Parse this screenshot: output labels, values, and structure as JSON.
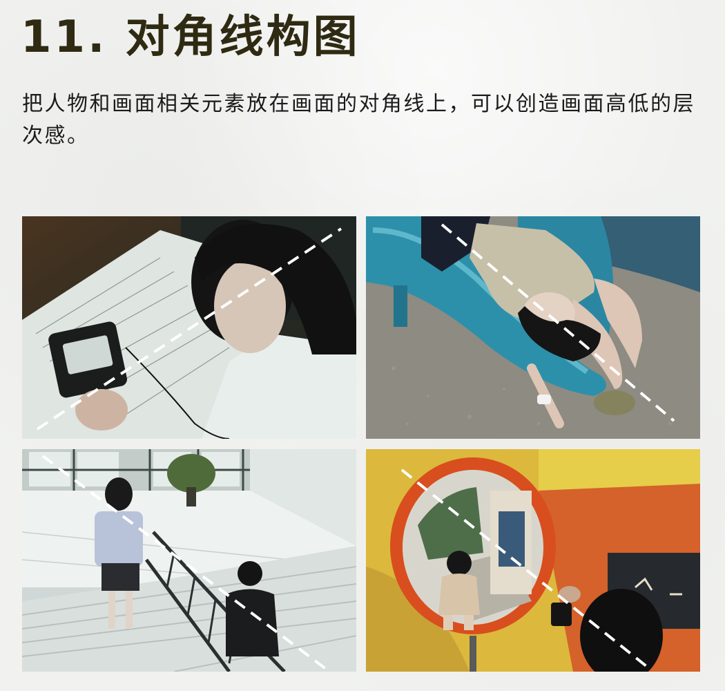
{
  "title": "11. 对角线构图",
  "description": "把人物和画面相关元素放在画面的对角线上，可以创造画面高低的层次感。",
  "photos": [
    {
      "name": "photo-girl-cassette-player"
    },
    {
      "name": "photo-girl-on-slide"
    },
    {
      "name": "photo-students-on-stairs"
    },
    {
      "name": "photo-convex-mirror"
    }
  ],
  "colors": {
    "title": "#2f2a12",
    "text": "#1b1b1b",
    "background": "#f1f2f0",
    "diagonal_line": "#ffffff"
  }
}
